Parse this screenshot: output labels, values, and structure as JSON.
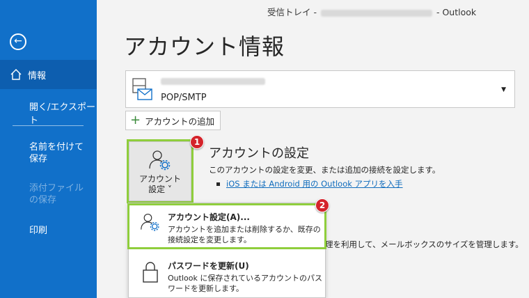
{
  "sidebar": {
    "items": {
      "info": "情報",
      "open_export": "開く/エクスポート",
      "save_as": "名前を付けて保存",
      "save_attachments": "添付ファイルの保存",
      "print": "印刷"
    }
  },
  "window": {
    "prefix": "受信トレイ -",
    "suffix": "-  Outlook"
  },
  "page": {
    "title": "アカウント情報"
  },
  "account": {
    "type": "POP/SMTP"
  },
  "add_account": {
    "label": "アカウントの追加"
  },
  "account_settings": {
    "button_line1": "アカウント",
    "button_line2": "設定 ˅",
    "title": "アカウントの設定",
    "description": "このアカウントの設定を変更、または追加の接続を設定します。",
    "link": "iOS または Android 用の Outlook アプリを入手"
  },
  "badges": {
    "one": "1",
    "two": "2"
  },
  "menu": {
    "item1": {
      "title": "アカウント設定(A)...",
      "description": "アカウントを追加または削除するか、既存の接続設定を変更します。"
    },
    "item2": {
      "title": "パスワードを更新(U)",
      "description": "Outlook に保存されているアカウントのパスワードを更新します。"
    }
  },
  "mailbox": {
    "text": "理を利用して、メールボックスのサイズを管理します。"
  },
  "colors": {
    "sidebar": "#1170c9",
    "sidebar_active": "#0d5eaf",
    "highlight": "#8fce3c",
    "badge": "#d4232b",
    "link": "#0f6cbd"
  }
}
